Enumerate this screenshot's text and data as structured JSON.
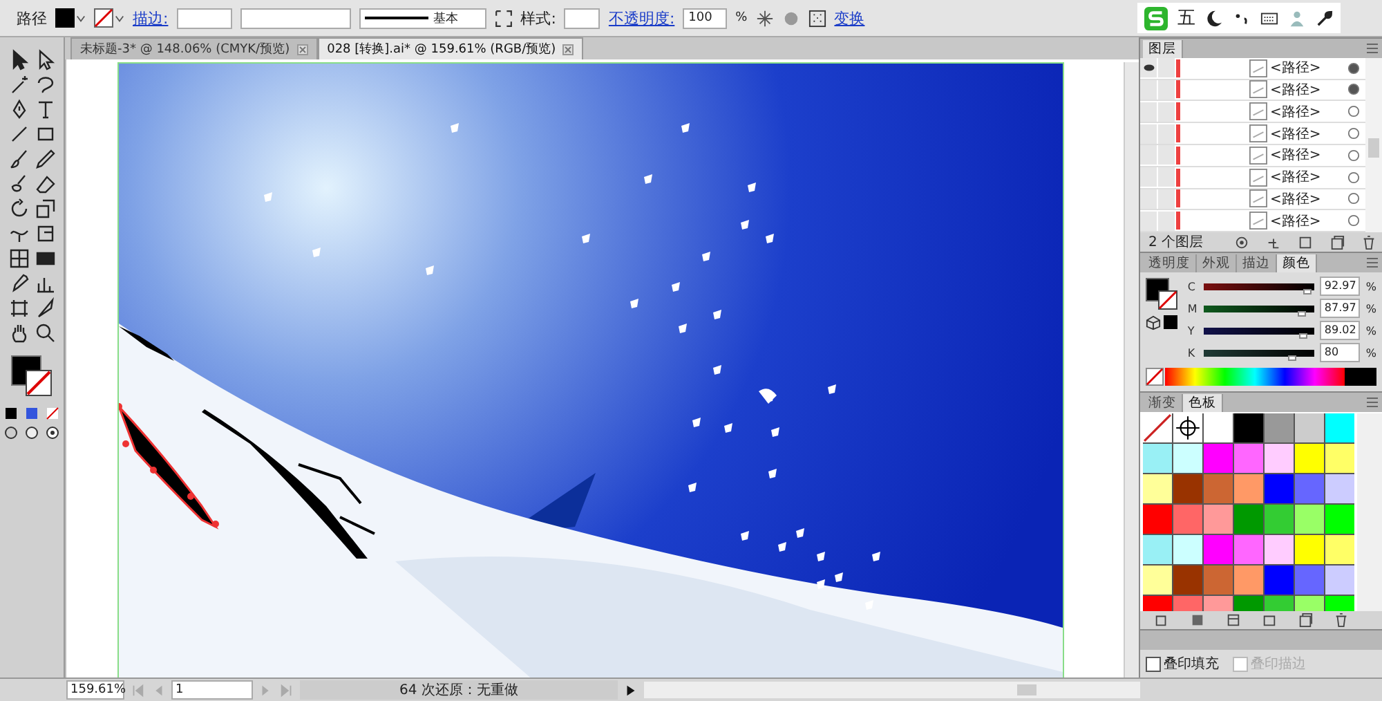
{
  "control_bar": {
    "selection_label": "路径",
    "stroke_label": "描边:",
    "stroke_style": "基本",
    "style_label": "样式:",
    "opacity_label": "不透明度:",
    "opacity_value": "100",
    "opacity_unit": "%",
    "transform_link": "变换"
  },
  "ime_bar": {
    "mode": "五"
  },
  "document_tabs": [
    {
      "title": "未标题-3* @ 148.06% (CMYK/预览)",
      "selected": false
    },
    {
      "title": "028 [转换].ai* @ 159.61% (RGB/预览)",
      "selected": true
    }
  ],
  "layers_panel": {
    "tab": "图层",
    "rows": [
      {
        "name": "<路径>",
        "visible": true,
        "targeted": true
      },
      {
        "name": "<路径>",
        "visible": false,
        "targeted": true
      },
      {
        "name": "<路径>",
        "visible": false,
        "targeted": false
      },
      {
        "name": "<路径>",
        "visible": false,
        "targeted": false
      },
      {
        "name": "<路径>",
        "visible": false,
        "targeted": false
      },
      {
        "name": "<路径>",
        "visible": false,
        "targeted": false
      },
      {
        "name": "<路径>",
        "visible": false,
        "targeted": false
      },
      {
        "name": "<路径>",
        "visible": false,
        "targeted": false
      }
    ],
    "footer": "2 个图层"
  },
  "color_panel": {
    "tabs": [
      {
        "label": "透明度",
        "selected": false
      },
      {
        "label": "外观",
        "selected": false
      },
      {
        "label": "描边",
        "selected": false
      },
      {
        "label": "颜色",
        "selected": true
      }
    ],
    "channels": [
      {
        "name": "C",
        "value": "92.97",
        "unit": "%",
        "level": 0.9297
      },
      {
        "name": "M",
        "value": "87.97",
        "unit": "%",
        "level": 0.8797
      },
      {
        "name": "Y",
        "value": "89.02",
        "unit": "%",
        "level": 0.8902
      },
      {
        "name": "K",
        "value": "80",
        "unit": "%",
        "level": 0.8
      }
    ]
  },
  "swatches_panel": {
    "tabs": [
      {
        "label": "渐变",
        "selected": false
      },
      {
        "label": "色板",
        "selected": true
      }
    ],
    "swatches": [
      {
        "kind": "none"
      },
      {
        "kind": "registration"
      },
      {
        "kind": "color",
        "color": "#ffffff"
      },
      {
        "kind": "color",
        "color": "#000000"
      },
      {
        "kind": "color",
        "color": "#999999"
      },
      {
        "kind": "color",
        "color": "#cccccc"
      },
      {
        "kind": "color",
        "color": "#00ffff"
      },
      {
        "kind": "color",
        "color": "#99f0f5"
      },
      {
        "kind": "color",
        "color": "#ccffff"
      },
      {
        "kind": "color",
        "color": "#ff00ff"
      },
      {
        "kind": "color",
        "color": "#ff66ff"
      },
      {
        "kind": "color",
        "color": "#ffccff"
      },
      {
        "kind": "color",
        "color": "#ffff00"
      },
      {
        "kind": "color",
        "color": "#ffff66"
      },
      {
        "kind": "color",
        "color": "#ffff99"
      },
      {
        "kind": "color",
        "color": "#993300"
      },
      {
        "kind": "color",
        "color": "#cc6633"
      },
      {
        "kind": "color",
        "color": "#ff9966"
      },
      {
        "kind": "color",
        "color": "#0000ff"
      },
      {
        "kind": "color",
        "color": "#6666ff"
      },
      {
        "kind": "color",
        "color": "#ccccff"
      },
      {
        "kind": "color",
        "color": "#ff0000"
      },
      {
        "kind": "color",
        "color": "#ff6666"
      },
      {
        "kind": "color",
        "color": "#ff9999"
      },
      {
        "kind": "color",
        "color": "#009900"
      },
      {
        "kind": "color",
        "color": "#33cc33"
      },
      {
        "kind": "color",
        "color": "#99ff66"
      },
      {
        "kind": "color",
        "color": "#00ff00"
      },
      {
        "kind": "color",
        "color": "#99f0f5"
      },
      {
        "kind": "color",
        "color": "#ccffff"
      },
      {
        "kind": "color",
        "color": "#ff00ff"
      },
      {
        "kind": "color",
        "color": "#ff66ff"
      },
      {
        "kind": "color",
        "color": "#ffccff"
      },
      {
        "kind": "color",
        "color": "#ffff00"
      },
      {
        "kind": "color",
        "color": "#ffff66"
      },
      {
        "kind": "color",
        "color": "#ffff99"
      },
      {
        "kind": "color",
        "color": "#993300"
      },
      {
        "kind": "color",
        "color": "#cc6633"
      },
      {
        "kind": "color",
        "color": "#ff9966"
      },
      {
        "kind": "color",
        "color": "#0000ff"
      },
      {
        "kind": "color",
        "color": "#6666ff"
      },
      {
        "kind": "color",
        "color": "#ccccff"
      },
      {
        "kind": "color",
        "color": "#ff0000"
      },
      {
        "kind": "color",
        "color": "#ff6666"
      },
      {
        "kind": "color",
        "color": "#ff9999"
      },
      {
        "kind": "color",
        "color": "#009900"
      },
      {
        "kind": "color",
        "color": "#33cc33"
      },
      {
        "kind": "color",
        "color": "#99ff66"
      },
      {
        "kind": "color",
        "color": "#00ff00"
      }
    ]
  },
  "attributes_panel": {
    "options": [
      {
        "label": "叠印填充",
        "checked": false,
        "disabled": false
      },
      {
        "label": "叠印描边",
        "checked": false,
        "disabled": true
      }
    ]
  },
  "status_bar": {
    "zoom": "159.61%",
    "page": "1",
    "message": "64 次还原：无重做"
  }
}
